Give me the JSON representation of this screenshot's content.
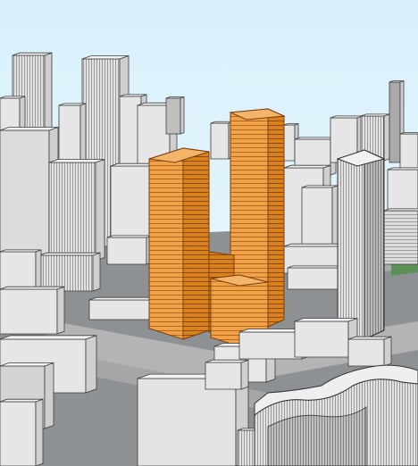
{
  "scene": {
    "type": "3d-massing-model",
    "colors": {
      "sky_top": "#d8f0fb",
      "sky_bottom": "#eef9fd",
      "ground": "#8e9194",
      "road": "#b8b8b8",
      "building_light": "#e6e6e6",
      "building_mid": "#cfcfcf",
      "building_dark": "#a8a8a8",
      "edge": "#3c3c3c",
      "proposed_tower_light": "#f0a248",
      "proposed_tower_dark": "#d9801f",
      "proposed_tower_line": "#8a4a10",
      "green_patch": "#5d8f58"
    },
    "proposed_towers": [
      {
        "name": "proposed-tower-west"
      },
      {
        "name": "proposed-tower-east"
      },
      {
        "name": "proposed-podium"
      }
    ]
  }
}
